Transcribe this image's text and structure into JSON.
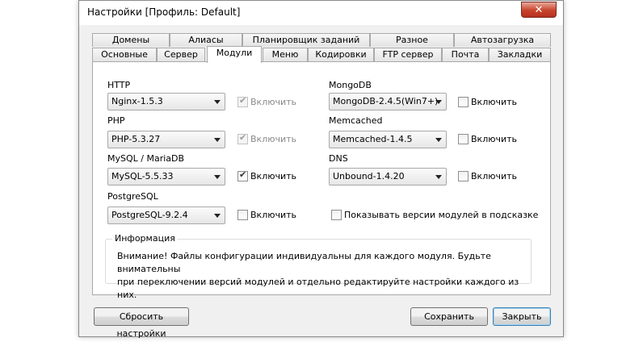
{
  "window": {
    "title": "Настройки [Профиль: Default]",
    "close_icon": "close-icon"
  },
  "tabs": {
    "row_back": [
      "Домены",
      "Алиасы",
      "Планировщик заданий",
      "Разное",
      "Автозагрузка"
    ],
    "row_front": [
      "Основные",
      "Сервер",
      "Модули",
      "Меню",
      "Кодировки",
      "FTP сервер",
      "Почта",
      "Закладки"
    ],
    "active": "Модули"
  },
  "modules": {
    "http": {
      "label": "HTTP",
      "value": "Nginx-1.5.3",
      "enable_label": "Включить",
      "checked": true,
      "disabled": true
    },
    "php": {
      "label": "PHP",
      "value": "PHP-5.3.27",
      "enable_label": "Включить",
      "checked": true,
      "disabled": true
    },
    "mysql": {
      "label": "MySQL / MariaDB",
      "value": "MySQL-5.5.33",
      "enable_label": "Включить",
      "checked": true,
      "disabled": false
    },
    "postgresql": {
      "label": "PostgreSQL",
      "value": "PostgreSQL-9.2.4",
      "enable_label": "Включить",
      "checked": false,
      "disabled": false
    },
    "mongodb": {
      "label": "MongoDB",
      "value": "MongoDB-2.4.5(Win7+)",
      "enable_label": "Включить",
      "checked": false,
      "disabled": false
    },
    "memcached": {
      "label": "Memcached",
      "value": "Memcached-1.4.5",
      "enable_label": "Включить",
      "checked": false,
      "disabled": false
    },
    "dns": {
      "label": "DNS",
      "value": "Unbound-1.4.20",
      "enable_label": "Включить",
      "checked": false,
      "disabled": false
    },
    "show_versions": {
      "label": "Показывать версии модулей в подсказке",
      "checked": false
    }
  },
  "info": {
    "legend": "Информация",
    "line1": "Внимание! Файлы конфигурации индивидуальны для каждого модуля. Будьте внимательны",
    "line2": "при переключении версий модулей и отдельно редактируйте настройки каждого из них."
  },
  "buttons": {
    "reset": "Сбросить настройки",
    "save": "Сохранить",
    "close": "Закрыть"
  },
  "check_mark": "✔"
}
